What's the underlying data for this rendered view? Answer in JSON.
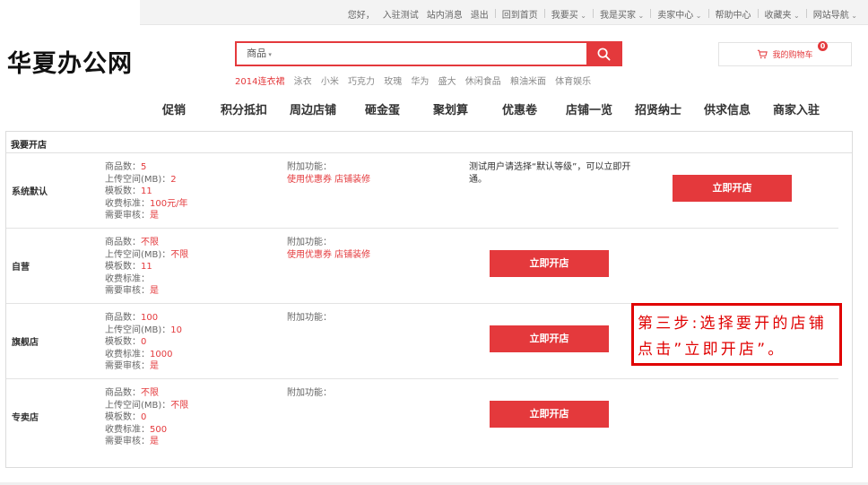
{
  "topnav": {
    "greeting": "您好，",
    "enter_test": "入驻测试",
    "messages": "站内消息",
    "logout": "退出",
    "home": "回到首页",
    "buy": "我要买",
    "buyer": "我是买家",
    "seller_center": "卖家中心",
    "help": "帮助中心",
    "favorites": "收藏夹",
    "site_nav": "网站导航"
  },
  "logo": {
    "text": "华夏办公网"
  },
  "search": {
    "category": "商品",
    "placeholder": "",
    "button_icon": "search-icon"
  },
  "hotwords": [
    "2014连衣裙",
    "泳衣",
    "小米",
    "巧克力",
    "玫瑰",
    "华为",
    "盛大",
    "休闲食品",
    "粮油米面",
    "体育娱乐"
  ],
  "cart": {
    "label": "我的购物车",
    "count": "0",
    "icon": "cart-icon"
  },
  "mainnav": [
    "促销",
    "积分抵扣",
    "周边店铺",
    "砸金蛋",
    "聚划算",
    "优惠卷",
    "店铺一览",
    "招贤纳士",
    "供求信息",
    "商家入驻"
  ],
  "panel": {
    "title": "我要开店",
    "open_label": "立即开店",
    "spec_labels": {
      "goods": "商品数：",
      "space": "上传空间(MB)：",
      "templates": "模板数：",
      "fee": "收费标准：",
      "review": "需要审核："
    },
    "extra_label": "附加功能：",
    "rows": [
      {
        "name": "系统默认",
        "goods": "5",
        "space": "2",
        "templates": "11",
        "fee": "100元/年",
        "review": "是",
        "extra_features": "使用优惠券 店铺装修",
        "note": "测试用户请选择“默认等级”，可以立即开通。"
      },
      {
        "name": "自营",
        "goods": "不限",
        "space": "不限",
        "templates": "11",
        "fee": "",
        "review": "是",
        "extra_features": "使用优惠券 店铺装修",
        "note": ""
      },
      {
        "name": "旗舰店",
        "goods": "100",
        "space": "10",
        "templates": "0",
        "fee": "1000",
        "review": "是",
        "extra_features": "",
        "note": ""
      },
      {
        "name": "专卖店",
        "goods": "不限",
        "space": "不限",
        "templates": "0",
        "fee": "500",
        "review": "是",
        "extra_features": "",
        "note": ""
      }
    ]
  },
  "callout": {
    "line1": "第三步:选择要开的店铺",
    "line2": "点击”立即开店”。"
  },
  "colors": {
    "accent": "#e4393c",
    "callout": "#e00000"
  }
}
